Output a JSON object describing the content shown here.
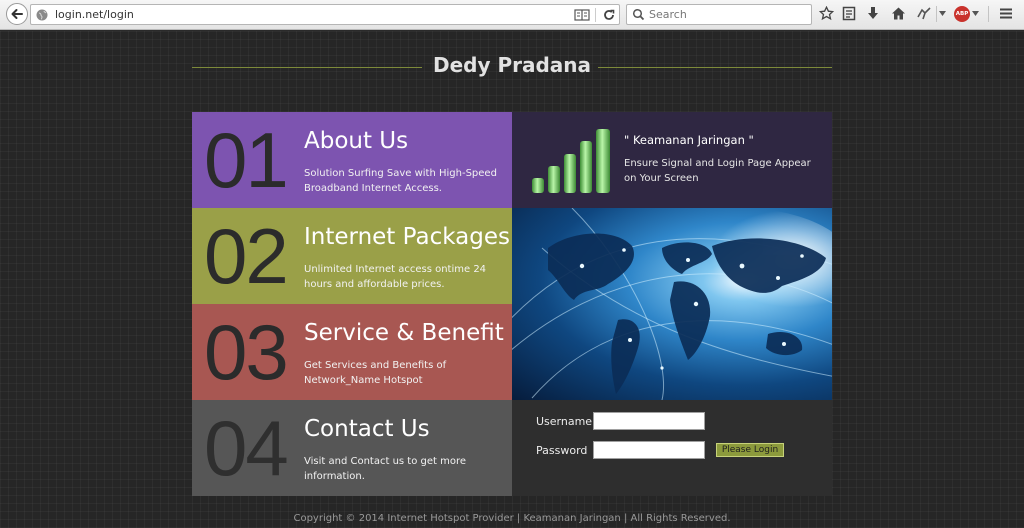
{
  "browser": {
    "url": "login.net/login",
    "search_placeholder": "Search",
    "adblock_label": "ABP"
  },
  "site": {
    "title": "Dedy Pradana"
  },
  "tiles": [
    {
      "number": "01",
      "title": "About Us",
      "description": "Solution Surfing Save with High-Speed Broadband Internet Access.",
      "color": "#7d54b0"
    },
    {
      "number": "02",
      "title": "Internet Packages",
      "description": "Unlimited Internet access ontime 24 hours and affordable prices.",
      "color": "#9aa048"
    },
    {
      "number": "03",
      "title": "Service & Benefit",
      "description": "Get Services and Benefits of Network_Name Hotspot",
      "color": "#a85752"
    },
    {
      "number": "04",
      "title": "Contact Us",
      "description": "Visit and Contact us to get more information.",
      "color": "#565656"
    }
  ],
  "security": {
    "title": "\" Keamanan Jaringan \"",
    "description": "Ensure Signal and Login Page Appear on Your Screen"
  },
  "login": {
    "username_label": "Username",
    "password_label": "Password",
    "username_value": "",
    "password_value": "",
    "button_label": "Please Login"
  },
  "footer": {
    "text": "Copyright © 2014 Internet Hotspot Provider | Keamanan Jaringan | All Rights Reserved."
  },
  "colors": {
    "accent": "#8c9a3c",
    "background": "#262626"
  }
}
